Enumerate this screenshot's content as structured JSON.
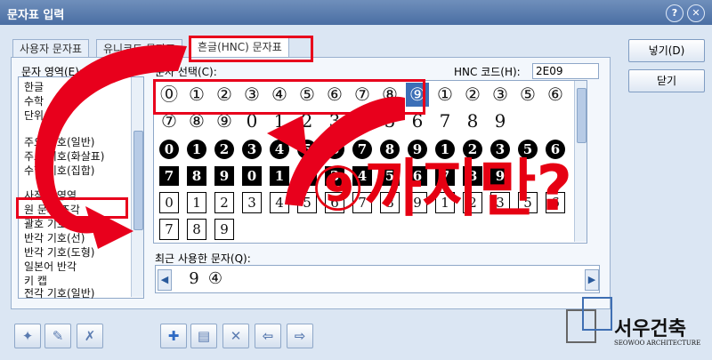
{
  "window": {
    "title": "문자표 입력",
    "help_glyph": "?",
    "close_glyph": "✕"
  },
  "tabs": [
    {
      "label": "사용자 문자표"
    },
    {
      "label": "유니코드 문자표"
    },
    {
      "label": "흔글(HNC) 문자표"
    }
  ],
  "sidebar": {
    "label": "문자 영역(E):",
    "items": [
      {
        "label": "한글"
      },
      {
        "label": "수학"
      },
      {
        "label": "단위"
      },
      {
        "label": "주요 기호(일반)"
      },
      {
        "label": "주요 기호(화살표)"
      },
      {
        "label": "수학 기호(집합)"
      },
      {
        "label": "사적용 영역"
      },
      {
        "label": "원 문자 조각"
      },
      {
        "label": "괄호 기호"
      },
      {
        "label": "반각 기호(선)"
      },
      {
        "label": "반각 기호(도형)"
      },
      {
        "label": "일본어 반각"
      },
      {
        "label": "키 캡"
      },
      {
        "label": "전각 기호(일반)"
      }
    ]
  },
  "char_select": {
    "label": "문자 선택(C):",
    "code_label": "HNC 코드(H):",
    "code_value": "2E09",
    "rows": [
      {
        "style": "circle",
        "chars": [
          "⓪",
          "①",
          "②",
          "③",
          "④",
          "⑤",
          "⑥",
          "⑦",
          "⑧",
          "⑨",
          "①",
          "②",
          "③",
          "⑤",
          "⑥"
        ]
      },
      {
        "style": "circle",
        "chars": [
          "⑦",
          "⑧",
          "⑨",
          "0",
          "1",
          "2",
          "3",
          "4",
          "5",
          "6",
          "7",
          "8",
          "9",
          "",
          ""
        ]
      },
      {
        "style": "inv",
        "chars": [
          "0",
          "1",
          "2",
          "3",
          "4",
          "5",
          "6",
          "7",
          "8",
          "9",
          "1",
          "2",
          "3",
          "5",
          "6"
        ]
      },
      {
        "style": "blk",
        "chars": [
          "7",
          "8",
          "9",
          "0",
          "1",
          "2",
          "3",
          "4",
          "5",
          "6",
          "7",
          "8",
          "9",
          "",
          ""
        ]
      },
      {
        "style": "box",
        "chars": [
          "0",
          "1",
          "2",
          "3",
          "4",
          "5",
          "6",
          "7",
          "8",
          "9",
          "1",
          "2",
          "3",
          "5",
          "6"
        ]
      },
      {
        "style": "box",
        "chars": [
          "7",
          "8",
          "9",
          "",
          "",
          "",
          "",
          "",
          "",
          "",
          "",
          "",
          "",
          "",
          ""
        ]
      }
    ],
    "selected_index": 9
  },
  "recent": {
    "label": "최근 사용한 문자(Q):",
    "chars": [
      "9",
      "④"
    ]
  },
  "buttons": {
    "insert": "넣기(D)",
    "close": "닫기"
  },
  "toolbar": {
    "tools": [
      "add",
      "edit",
      "delete",
      "plus",
      "insert-row",
      "cross",
      "left",
      "right"
    ]
  },
  "overlay": {
    "caption": "⑨까지만?",
    "colors": {
      "accent": "#e60012"
    }
  },
  "logo": {
    "korean": "서우건축",
    "english": "SEOWOO ARCHITECTURE"
  }
}
